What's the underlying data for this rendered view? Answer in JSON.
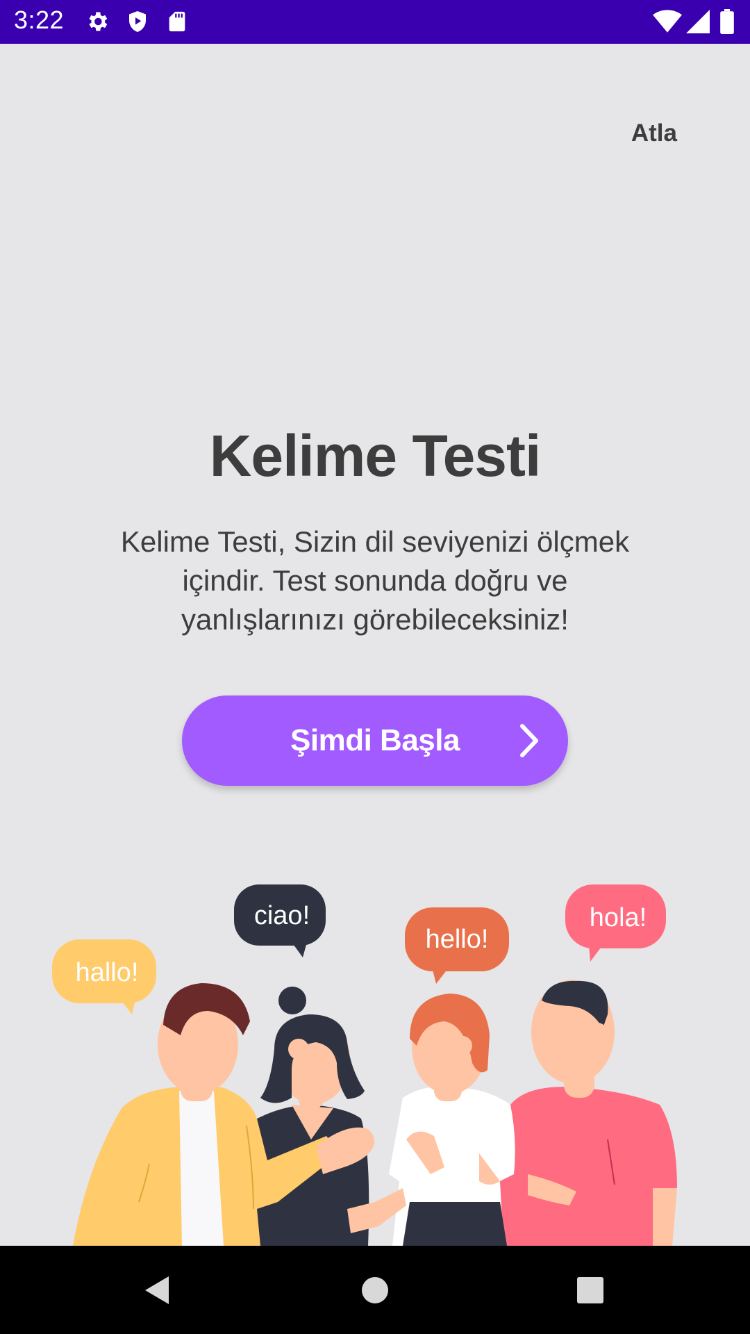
{
  "status_bar": {
    "time": "3:22",
    "left_icons": [
      "gear-icon",
      "shield-play-icon",
      "sd-card-icon"
    ],
    "right_icons": [
      "wifi-icon",
      "signal-icon",
      "battery-icon"
    ]
  },
  "header": {
    "skip_label": "Atla"
  },
  "main": {
    "title": "Kelime Testi",
    "description": "Kelime Testi, Sizin dil seviyenizi ölçmek içindir. Test sonunda doğru ve yanlışlarınızı görebileceksiniz!",
    "start_button_label": "Şimdi Başla"
  },
  "illustration": {
    "bubbles": [
      "hallo!",
      "ciao!",
      "hello!",
      "hola!"
    ],
    "colors": {
      "yellow": "#ffcb6b",
      "navy": "#2f3341",
      "orange": "#e8704a",
      "pink": "#ff6b81",
      "skin": "#ffc4a3",
      "hair_brown": "#6a2a2a"
    }
  },
  "colors": {
    "status_bar": "#3a00b0",
    "background": "#e6e5e7",
    "accent": "#a25bff",
    "text": "#3d3d3d"
  },
  "nav_bar": {
    "icons": [
      "back-icon",
      "home-icon",
      "recents-icon"
    ]
  }
}
